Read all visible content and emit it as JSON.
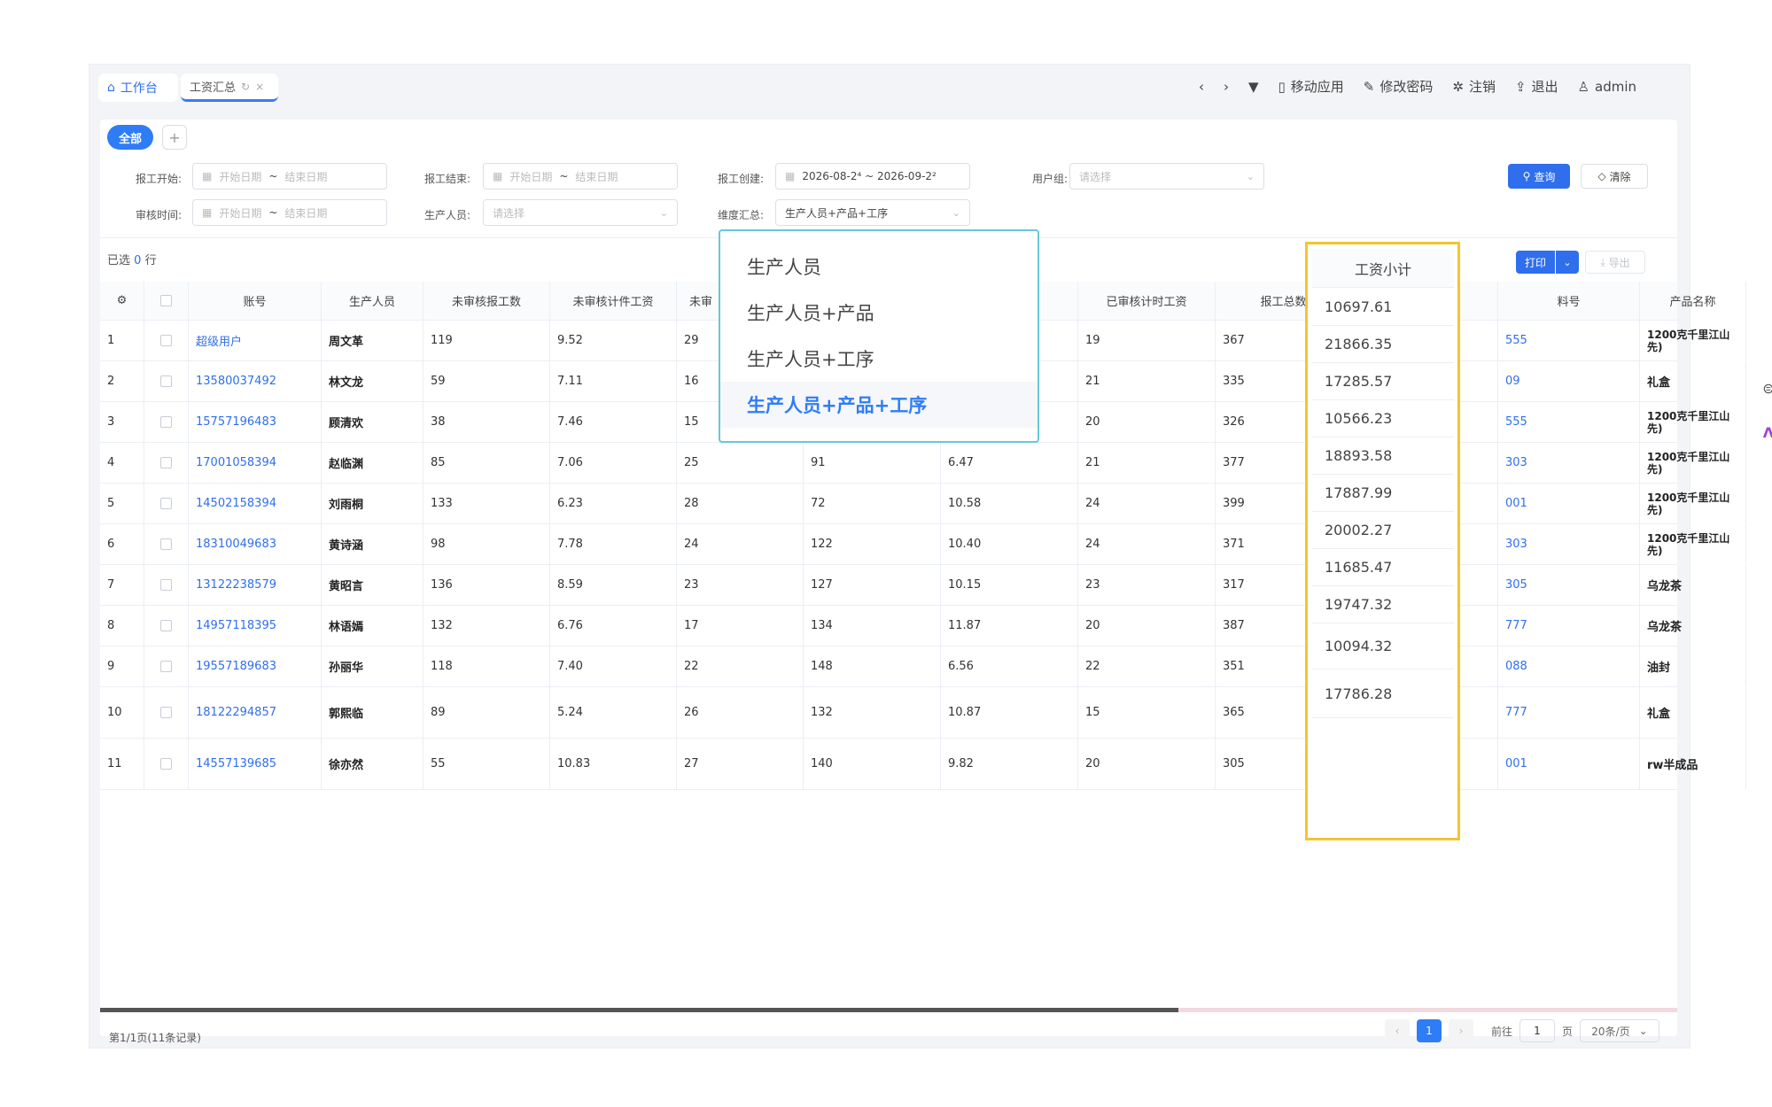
{
  "tabs": [
    {
      "label": "工作台",
      "icon": "home-icon"
    },
    {
      "label": "工资汇总",
      "icon": "refresh-icon"
    }
  ],
  "top_actions": [
    {
      "label": "移动应用",
      "icon": "mobile-icon"
    },
    {
      "label": "修改密码",
      "icon": "edit-icon"
    },
    {
      "label": "注销",
      "icon": "spinner-icon"
    },
    {
      "label": "退出",
      "icon": "logout-icon"
    },
    {
      "label": "admin",
      "icon": "user-icon"
    }
  ],
  "filter_chip": {
    "all": "全部",
    "add": "+"
  },
  "filters": {
    "report_start": {
      "label": "报工开始:",
      "start_placeholder": "开始日期",
      "sep": "~",
      "end_placeholder": "结束日期"
    },
    "report_end": {
      "label": "报工结束:",
      "start_placeholder": "开始日期",
      "sep": "~",
      "end_placeholder": "结束日期"
    },
    "report_created": {
      "label": "报工创建:",
      "value": "2026-08-2⁴ ~ 2026-09-2²"
    },
    "user_group": {
      "label": "用户组:",
      "placeholder": "请选择"
    },
    "audit_time": {
      "label": "审核时间:",
      "start_placeholder": "开始日期",
      "sep": "~",
      "end_placeholder": "结束日期"
    },
    "producer": {
      "label": "生产人员:",
      "placeholder": "请选择"
    },
    "dimension": {
      "label": "维度汇总:",
      "value": "生产人员+产品+工序"
    }
  },
  "buttons": {
    "query": "查询",
    "clear": "清除",
    "print": "打印",
    "export": "导出"
  },
  "selection": {
    "prefix": "已选",
    "count": "0",
    "suffix": "行"
  },
  "table": {
    "headers": [
      "账号",
      "生产人员",
      "未审核报工数",
      "未审核计件工资",
      "未审",
      "已审核计时工资",
      "报工总数",
      "料号",
      "产品名称"
    ],
    "rows": [
      {
        "no": "1",
        "account": "超级用户",
        "person": "周文革",
        "c1": "119",
        "c2": "9.52",
        "c3": "29",
        "c4": "",
        "c5": "",
        "c6": "19",
        "c7": "367",
        "part": "555",
        "product": "1200克千里江山先)"
      },
      {
        "no": "2",
        "account": "13580037492",
        "person": "林文龙",
        "c1": "59",
        "c2": "7.11",
        "c3": "16",
        "c4": "",
        "c5": "",
        "c6": "21",
        "c7": "335",
        "part": "09",
        "product": "礼盒"
      },
      {
        "no": "3",
        "account": "15757196483",
        "person": "顾清欢",
        "c1": "38",
        "c2": "7.46",
        "c3": "15",
        "c4": "",
        "c5": "",
        "c6": "20",
        "c7": "326",
        "part": "555",
        "product": "1200克千里江山先)"
      },
      {
        "no": "4",
        "account": "17001058394",
        "person": "赵临渊",
        "c1": "85",
        "c2": "7.06",
        "c3": "25",
        "c4": "91",
        "c5": "6.47",
        "c6": "21",
        "c7": "377",
        "part": "303",
        "product": "1200克千里江山先)"
      },
      {
        "no": "5",
        "account": "14502158394",
        "person": "刘雨桐",
        "c1": "133",
        "c2": "6.23",
        "c3": "28",
        "c4": "72",
        "c5": "10.58",
        "c6": "24",
        "c7": "399",
        "part": "001",
        "product": "1200克千里江山先)"
      },
      {
        "no": "6",
        "account": "18310049683",
        "person": "黄诗涵",
        "c1": "98",
        "c2": "7.78",
        "c3": "24",
        "c4": "122",
        "c5": "10.40",
        "c6": "24",
        "c7": "371",
        "part": "303",
        "product": "1200克千里江山先)"
      },
      {
        "no": "7",
        "account": "13122238579",
        "person": "黄昭言",
        "c1": "136",
        "c2": "8.59",
        "c3": "23",
        "c4": "127",
        "c5": "10.15",
        "c6": "23",
        "c7": "317",
        "part": "305",
        "product": "乌龙茶"
      },
      {
        "no": "8",
        "account": "14957118395",
        "person": "林语嫣",
        "c1": "132",
        "c2": "6.76",
        "c3": "17",
        "c4": "134",
        "c5": "11.87",
        "c6": "20",
        "c7": "387",
        "part": "777",
        "product": "乌龙茶"
      },
      {
        "no": "9",
        "account": "19557189683",
        "person": "孙丽华",
        "c1": "118",
        "c2": "7.40",
        "c3": "22",
        "c4": "148",
        "c5": "6.56",
        "c6": "22",
        "c7": "351",
        "part": "088",
        "product": "油封"
      },
      {
        "no": "10",
        "account": "18122294857",
        "person": "郭熙临",
        "c1": "89",
        "c2": "5.24",
        "c3": "26",
        "c4": "132",
        "c5": "10.87",
        "c6": "15",
        "c7": "365",
        "part": "777",
        "product": "礼盒"
      },
      {
        "no": "11",
        "account": "14557139685",
        "person": "徐亦然",
        "c1": "55",
        "c2": "10.83",
        "c3": "27",
        "c4": "140",
        "c5": "9.82",
        "c6": "20",
        "c7": "305",
        "part": "001",
        "product": "rw半成品"
      }
    ]
  },
  "wage_column": {
    "header": "工资小计",
    "values": [
      "10697.61",
      "21866.35",
      "17285.57",
      "10566.23",
      "18893.58",
      "17887.99",
      "20002.27",
      "11685.47",
      "19747.32",
      "10094.32",
      "17786.28"
    ]
  },
  "dropdown": {
    "options": [
      "生产人员",
      "生产人员+产品",
      "生产人员+工序",
      "生产人员+产品+工序"
    ],
    "selected": "生产人员+产品+工序"
  },
  "footer": {
    "summary": "第1/1页(11条记录)",
    "prev": "‹",
    "page": "1",
    "next": "›",
    "goto_label": "前往",
    "goto_value": "1",
    "page_unit": "页",
    "page_size": "20条/页"
  },
  "colors": {
    "accent": "#2f7df6",
    "highlight_border": "#f4c430",
    "dropdown_border": "#66c8d8"
  }
}
